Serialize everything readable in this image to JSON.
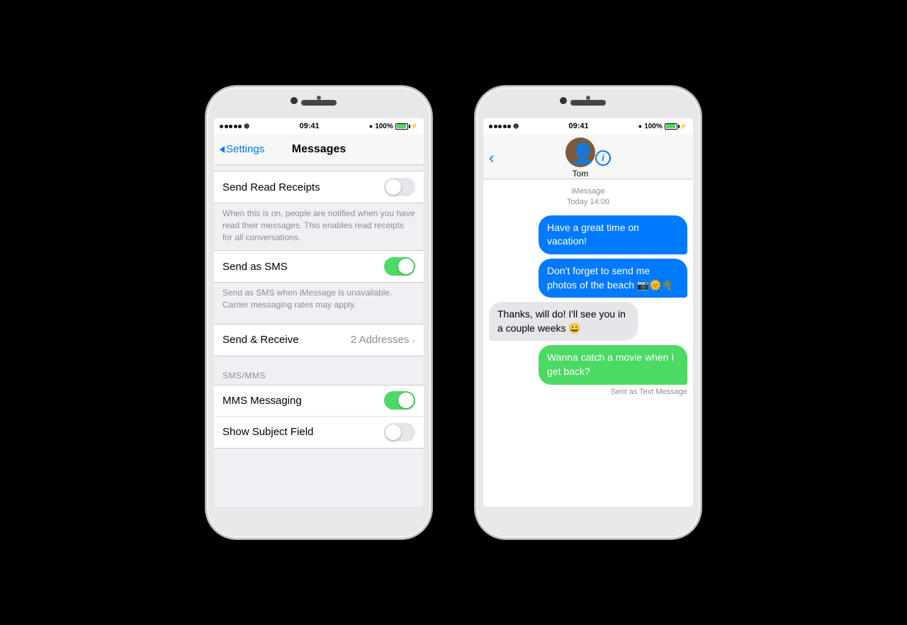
{
  "background": "#000000",
  "phone1": {
    "statusBar": {
      "time": "09:41",
      "battery": "100%",
      "signal": "●●●●●"
    },
    "nav": {
      "back": "Settings",
      "title": "Messages"
    },
    "rows": [
      {
        "label": "Send Read Receipts",
        "type": "toggle",
        "value": false
      },
      {
        "description": "When this is on, people are notified when you have read their messages. This enables read receipts for all conversations."
      },
      {
        "label": "Send as SMS",
        "type": "toggle",
        "value": true
      },
      {
        "description": "Send as SMS when iMessage is unavailable. Carrier messaging rates may apply."
      },
      {
        "label": "Send & Receive",
        "type": "value",
        "value": "2 Addresses"
      }
    ],
    "section2Header": "SMS/MMS",
    "rows2": [
      {
        "label": "MMS Messaging",
        "type": "toggle",
        "value": true
      },
      {
        "label": "Show Subject Field",
        "type": "toggle",
        "value": false
      }
    ]
  },
  "phone2": {
    "statusBar": {
      "time": "09:41",
      "battery": "100%"
    },
    "contact": {
      "name": "Tom"
    },
    "timestamp": {
      "type": "iMessage",
      "time": "Today 14:00"
    },
    "messages": [
      {
        "type": "sent",
        "text": "Have a great time on vacation!",
        "color": "blue"
      },
      {
        "type": "sent",
        "text": "Don't forget to send me photos of the beach 📷🌞🌴",
        "color": "blue"
      },
      {
        "type": "received",
        "text": "Thanks, will do! I'll see you in a couple weeks 😀",
        "color": "gray"
      },
      {
        "type": "sent",
        "text": "Wanna catch a movie when I get back?",
        "color": "green",
        "label": "Sent as Text Message"
      }
    ]
  }
}
